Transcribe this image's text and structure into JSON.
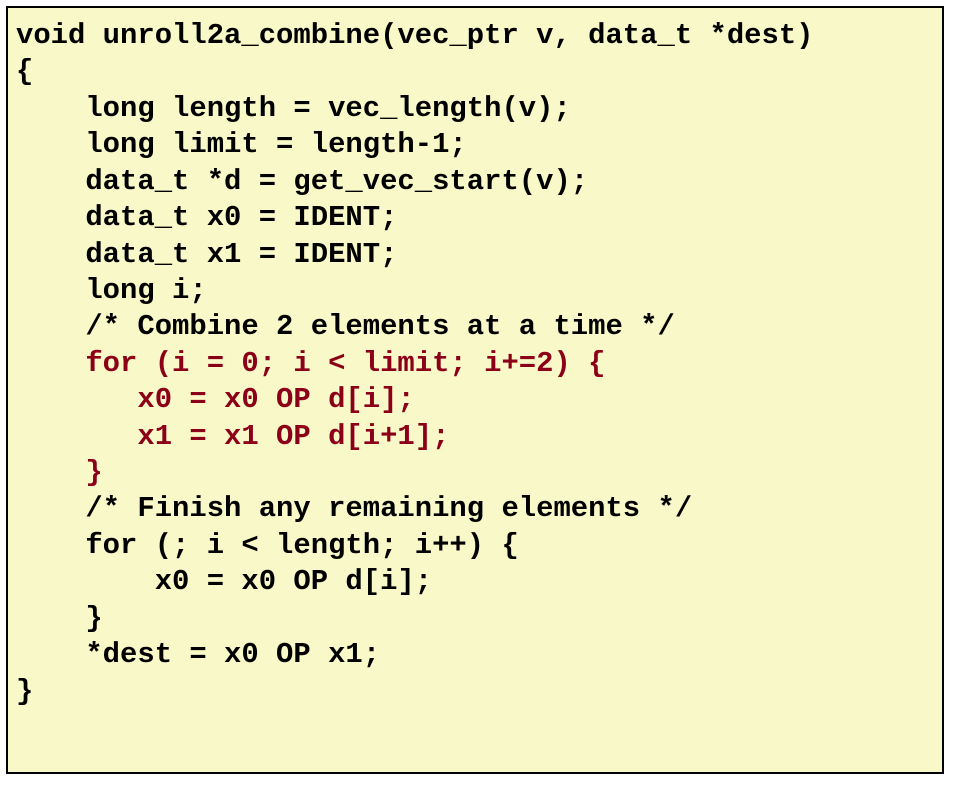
{
  "code": {
    "line1": "void unroll2a_combine(vec_ptr v, data_t *dest)",
    "line2": "{",
    "line3": "    long length = vec_length(v);",
    "line4": "    long limit = length-1;",
    "line5": "    data_t *d = get_vec_start(v);",
    "line6": "    data_t x0 = IDENT;",
    "line7": "    data_t x1 = IDENT;",
    "line8": "    long i;",
    "line9": "    /* Combine 2 elements at a time */",
    "line10": "    for (i = 0; i < limit; i+=2) {",
    "line11": "       x0 = x0 OP d[i];",
    "line12": "       x1 = x1 OP d[i+1];",
    "line13": "    }",
    "line14": "    /* Finish any remaining elements */",
    "line15": "    for (; i < length; i++) {",
    "line16": "        x0 = x0 OP d[i];",
    "line17": "    }",
    "line18": "    *dest = x0 OP x1;",
    "line19": "}"
  }
}
